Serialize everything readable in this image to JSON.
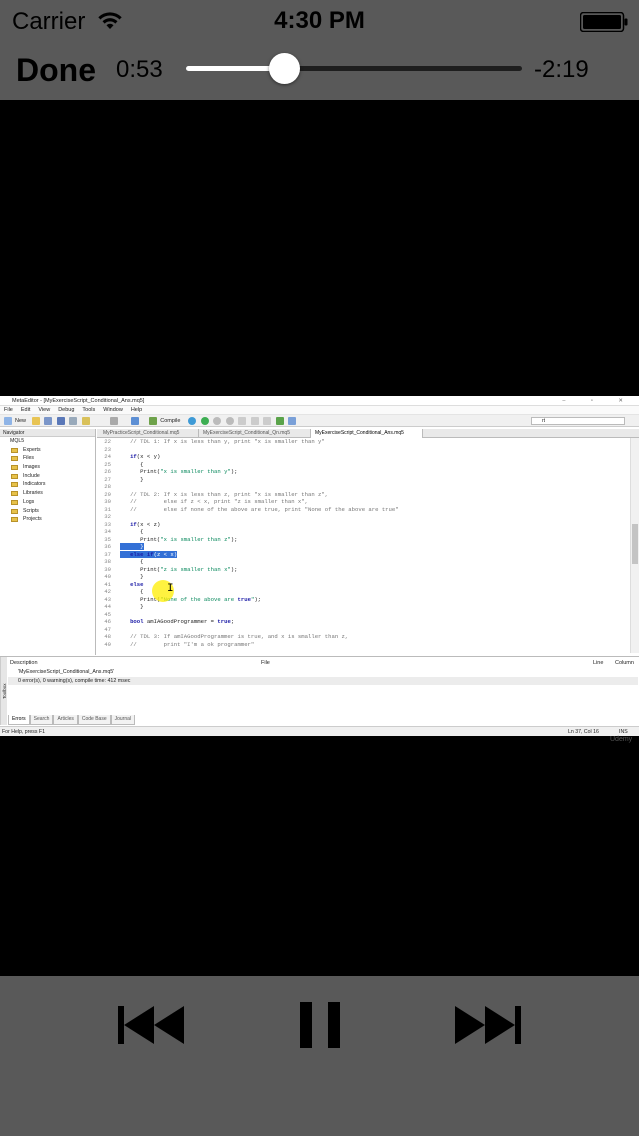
{
  "status_bar": {
    "carrier": "Carrier",
    "time": "4:30 PM",
    "wifi_icon": "wifi-icon",
    "battery_icon": "battery-icon"
  },
  "player": {
    "done_label": "Done",
    "elapsed": "0:53",
    "remaining": "-2:19",
    "progress_fraction": 0.292,
    "controls": {
      "prev_icon": "skip-back-icon",
      "pause_icon": "pause-icon",
      "next_icon": "skip-forward-icon"
    }
  },
  "video": {
    "window_title": "MetaEditor - [MyExerciseScript_Conditional_Ans.mq5]",
    "menu": [
      "File",
      "Edit",
      "View",
      "Debug",
      "Tools",
      "Window",
      "Help"
    ],
    "toolbar": {
      "new_label": "New",
      "compile_label": "Compile",
      "search_value": "rt"
    },
    "navigator": {
      "title": "Navigator",
      "root": "MQL5",
      "items": [
        "Experts",
        "Files",
        "Images",
        "Include",
        "Indicators",
        "Libraries",
        "Logs",
        "Scripts",
        "Projects"
      ]
    },
    "tabs": [
      "MyPracticeScript_Conditional.mq5",
      "MyExerciseScript_Conditional_Qn.mq5",
      "MyExerciseScript_Conditional_Ans.mq5"
    ],
    "code_lines": [
      {
        "n": "22",
        "t": "   // TDL 1: If x is less than y, print \"x is smaller than y\""
      },
      {
        "n": "23",
        "t": ""
      },
      {
        "n": "24",
        "t": "   if(x < y)"
      },
      {
        "n": "25",
        "t": "      {"
      },
      {
        "n": "26",
        "t": "      Print(\"x is smaller than y\");"
      },
      {
        "n": "27",
        "t": "      }"
      },
      {
        "n": "28",
        "t": ""
      },
      {
        "n": "29",
        "t": "   // TDL 2: If x is less than z, print \"x is smaller than z\","
      },
      {
        "n": "30",
        "t": "   //        else if z < x, print \"z is smaller than x\","
      },
      {
        "n": "31",
        "t": "   //        else if none of the above are true, print \"None of the above are true\""
      },
      {
        "n": "32",
        "t": ""
      },
      {
        "n": "33",
        "t": "   if(x < z)"
      },
      {
        "n": "34",
        "t": "      {"
      },
      {
        "n": "35",
        "t": "      Print(\"x is smaller than z\");"
      },
      {
        "n": "36",
        "t": "      }"
      },
      {
        "n": "37",
        "t": "   else if(z < x)"
      },
      {
        "n": "38",
        "t": "      {"
      },
      {
        "n": "39",
        "t": "      Print(\"z is smaller than x\");"
      },
      {
        "n": "40",
        "t": "      }"
      },
      {
        "n": "41",
        "t": "   else"
      },
      {
        "n": "42",
        "t": "      {"
      },
      {
        "n": "43",
        "t": "      Print(\"None of the above are true\");"
      },
      {
        "n": "44",
        "t": "      }"
      },
      {
        "n": "45",
        "t": ""
      },
      {
        "n": "46",
        "t": "   bool amIAGoodProgrammer = true;"
      },
      {
        "n": "47",
        "t": ""
      },
      {
        "n": "48",
        "t": "   // TDL 3: If amIAGoodProgrammer is true, and x is smaller than z,"
      },
      {
        "n": "49",
        "t": "   //        print \"I'm a ok programmer\""
      }
    ],
    "toolbox": {
      "side_label": "Toolbox",
      "columns": [
        "Description",
        "File",
        "Line",
        "Column"
      ],
      "rows": [
        "'MyExerciseScript_Conditional_Ans.mq5'",
        "0 error(s), 0 warning(s), compile time: 412 msec"
      ],
      "tabs": [
        "Errors",
        "Search",
        "Articles",
        "Code Base",
        "Journal"
      ]
    },
    "status": {
      "help": "For Help, press F1",
      "position": "Ln 37, Col 16",
      "mode": "INS"
    },
    "watermark": "Udemy"
  }
}
